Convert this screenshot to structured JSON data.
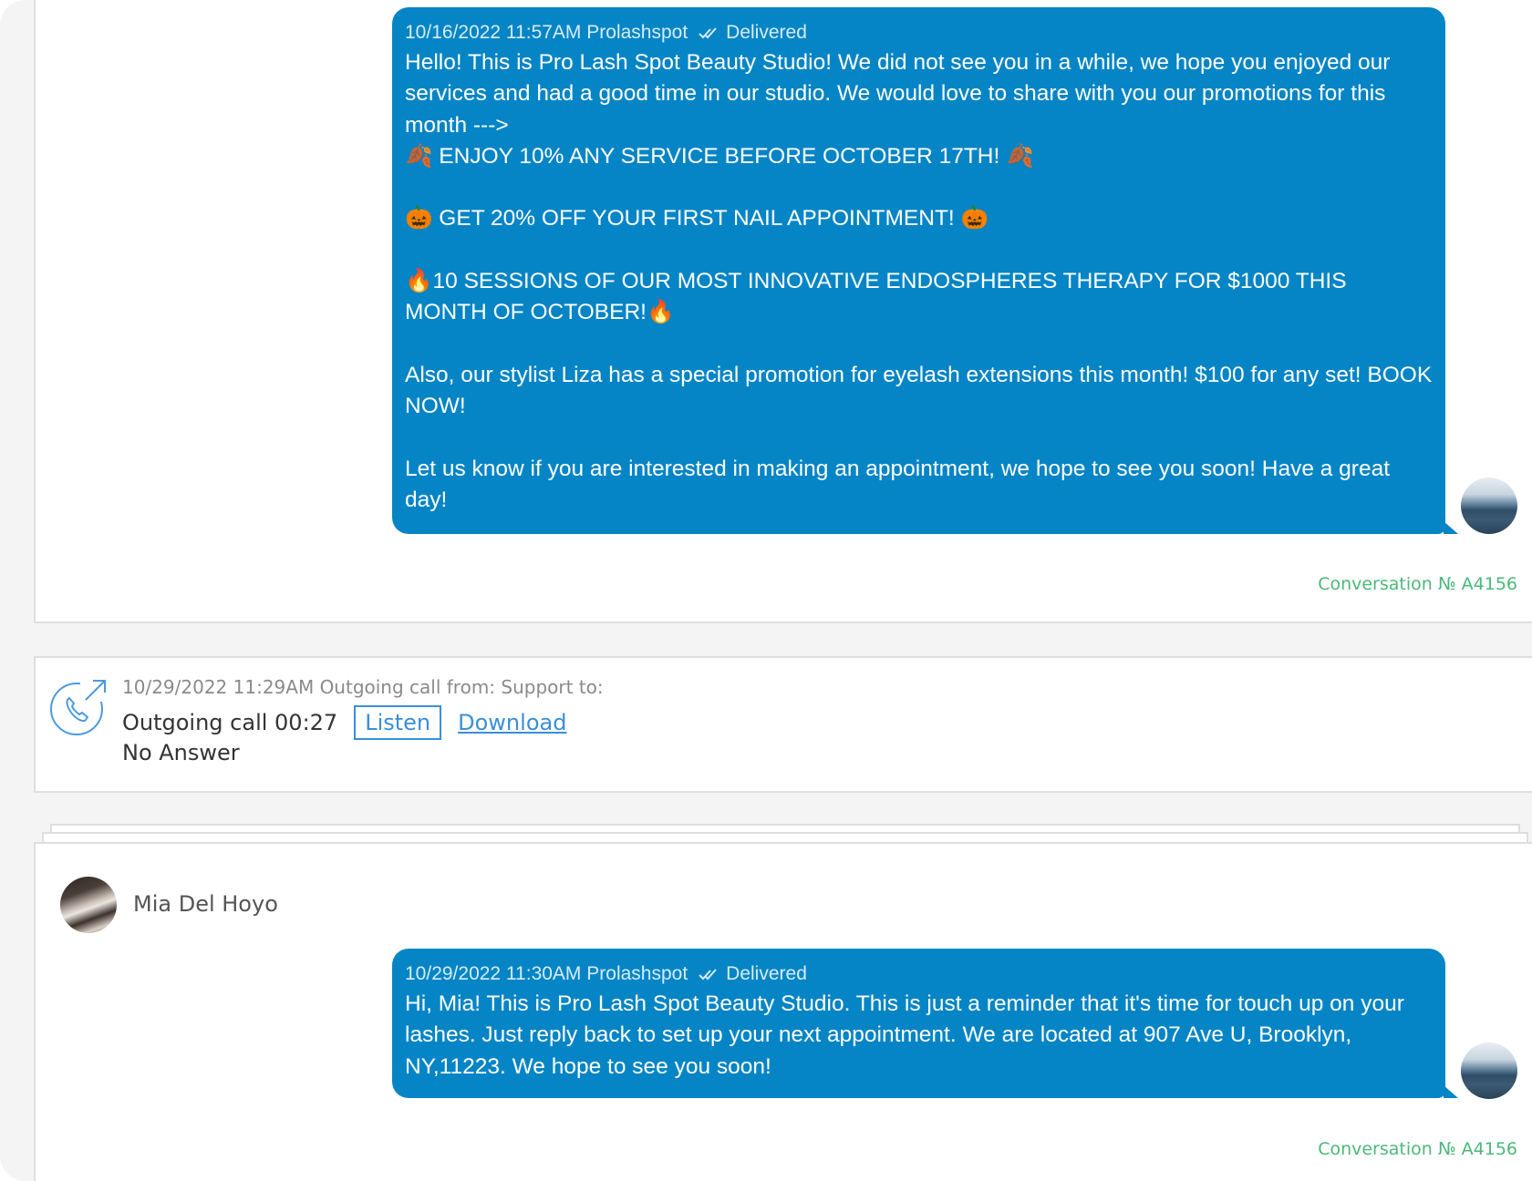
{
  "messages": [
    {
      "meta": "10/16/2022 11:57AM Prolashspot",
      "status": "Delivered",
      "body": "Hello! This is Pro Lash Spot Beauty Studio! We did not see you in a while, we hope you enjoyed our services and had a good time in our studio. We would love to share with you our promotions for this month --->\n🍂 ENJOY 10% ANY SERVICE BEFORE OCTOBER 17TH! 🍂\n\n🎃 GET 20% OFF YOUR FIRST NAIL APPOINTMENT! 🎃\n\n🔥10 SESSIONS OF OUR MOST INNOVATIVE ENDOSPHERES THERAPY FOR $1000 THIS MONTH OF OCTOBER!🔥\n\nAlso, our stylist Liza has a special promotion for eyelash extensions this month! $100 for any set! BOOK NOW!\n\nLet us know if you are interested in making an appointment, we hope to see you soon! Have a great day!",
      "conversation": "Conversation № A4156"
    },
    {
      "meta": "10/29/2022 11:30AM Prolashspot",
      "status": "Delivered",
      "body": "Hi, Mia! This is Pro Lash Spot Beauty Studio. This is just a reminder that it's time for touch up on your lashes. Just reply back to set up your next appointment. We are located at 907 Ave U, Brooklyn, NY,11223. We hope to see you soon!",
      "conversation": "Conversation № A4156"
    }
  ],
  "call": {
    "meta": "10/29/2022 11:29AM Outgoing call from: Support to:",
    "label": "Outgoing call 00:27",
    "listen_label": "Listen",
    "download_label": "Download",
    "status": "No Answer",
    "icon": "outgoing-call-icon"
  },
  "contact": {
    "name": "Mia Del Hoyo"
  },
  "colors": {
    "bubble": "#0585c6",
    "conversation_link": "#4cb87a",
    "link": "#3a8fd8"
  }
}
